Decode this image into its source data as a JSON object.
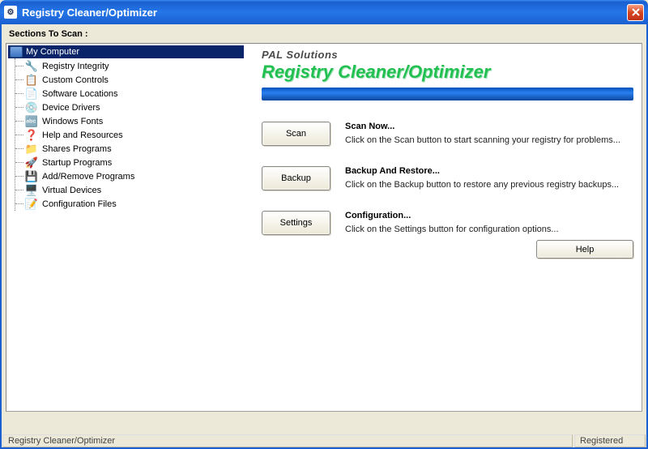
{
  "window": {
    "title": "Registry Cleaner/Optimizer"
  },
  "sidebar": {
    "heading": "Sections To Scan :",
    "root": "My Computer",
    "items": [
      {
        "icon": "🔧",
        "label": "Registry Integrity"
      },
      {
        "icon": "📋",
        "label": "Custom Controls"
      },
      {
        "icon": "📄",
        "label": "Software Locations"
      },
      {
        "icon": "💿",
        "label": "Device Drivers"
      },
      {
        "icon": "🔤",
        "label": "Windows Fonts"
      },
      {
        "icon": "❓",
        "label": "Help and Resources"
      },
      {
        "icon": "📁",
        "label": "Shares Programs"
      },
      {
        "icon": "🚀",
        "label": "Startup Programs"
      },
      {
        "icon": "💾",
        "label": "Add/Remove Programs"
      },
      {
        "icon": "🖥️",
        "label": "Virtual Devices"
      },
      {
        "icon": "📝",
        "label": "Configuration Files"
      }
    ]
  },
  "brand": {
    "small": "PAL Solutions",
    "big": "Registry Cleaner/Optimizer"
  },
  "actions": {
    "scan": {
      "button": "Scan",
      "title": "Scan Now...",
      "desc": "Click on the Scan button to start scanning your registry for problems..."
    },
    "backup": {
      "button": "Backup",
      "title": "Backup And Restore...",
      "desc": "Click on the Backup button to restore any previous registry backups..."
    },
    "settings": {
      "button": "Settings",
      "title": "Configuration...",
      "desc": "Click on the Settings button for configuration options..."
    },
    "help": "Help"
  },
  "status": {
    "left": "Registry Cleaner/Optimizer",
    "right": "Registered"
  }
}
